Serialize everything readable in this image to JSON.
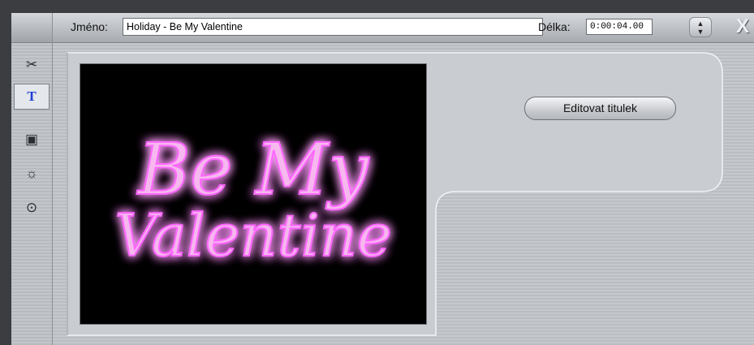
{
  "header": {
    "name_label": "Jméno:",
    "name_value": "Holiday - Be My Valentine",
    "duration_label": "Délka:",
    "duration_value": "0:00:04.00",
    "close_label": "X"
  },
  "toolbar": {
    "items": [
      {
        "icon": "scissors-icon",
        "glyph": "✂",
        "active": false
      },
      {
        "icon": "title-text-icon",
        "glyph": "T",
        "active": true
      },
      {
        "icon": "camera-icon",
        "glyph": "▣",
        "active": false
      },
      {
        "icon": "brightness-icon",
        "glyph": "☼",
        "active": false
      },
      {
        "icon": "speed-icon",
        "glyph": "⊙",
        "active": false
      }
    ]
  },
  "preview": {
    "line1": "Be My",
    "line2": "Valentine",
    "text_color": "#f6b8ee",
    "glow_color": "#ff66ff"
  },
  "actions": {
    "edit_title_label": "Editovat titulek"
  }
}
